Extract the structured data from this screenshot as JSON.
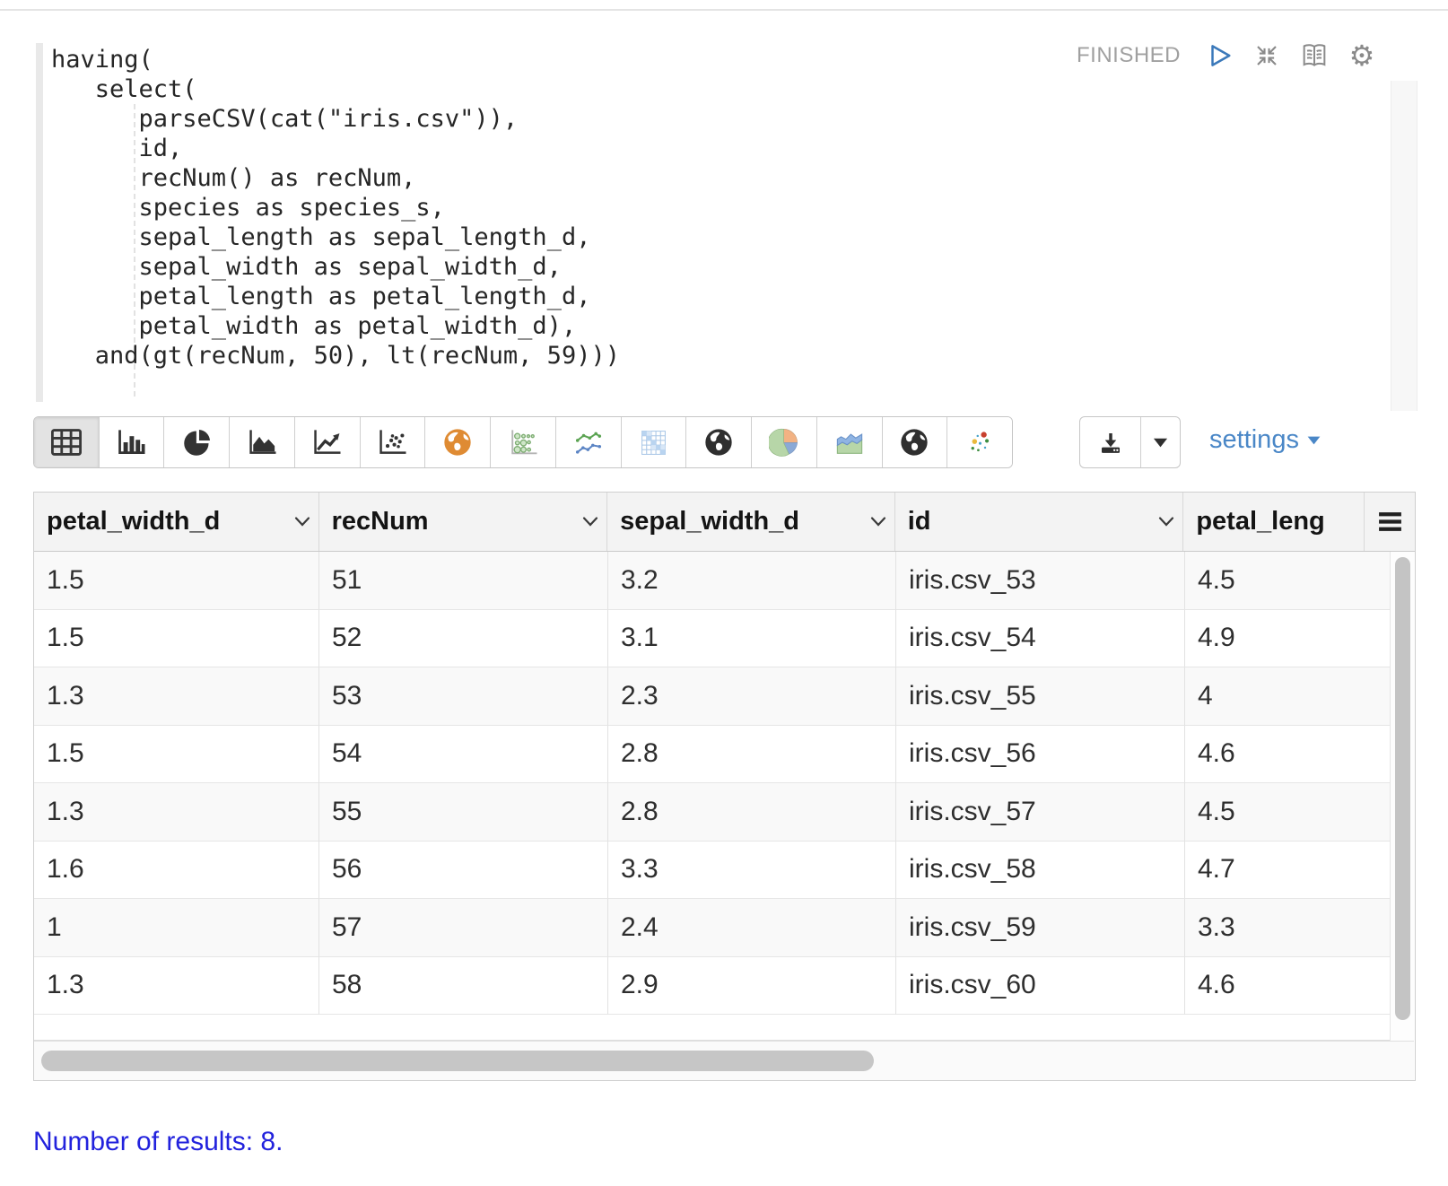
{
  "paragraph": {
    "status": "FINISHED",
    "controls": [
      "play",
      "compress",
      "book",
      "gear"
    ],
    "code": "having(\n   select(\n      parseCSV(cat(\"iris.csv\")),\n      id,\n      recNum() as recNum,\n      species as species_s,\n      sepal_length as sepal_length_d,\n      sepal_width as sepal_width_d,\n      petal_length as petal_length_d,\n      petal_width as petal_width_d),\n   and(gt(recNum, 50), lt(recNum, 59)))"
  },
  "toolbar": {
    "chart_types": [
      "table",
      "bar-chart",
      "pie-chart",
      "area-chart",
      "line-chart",
      "scatter-chart",
      "map-globe-orange",
      "bubble-chart",
      "multi-line-chart",
      "heatmap",
      "globe-dark",
      "pie-chart-colored",
      "area-chart-colored",
      "globe-dark-2",
      "scatter-colored"
    ],
    "selected_chart": "table",
    "settings_label": "settings"
  },
  "table": {
    "columns": [
      {
        "label": "petal_width_d"
      },
      {
        "label": "recNum"
      },
      {
        "label": "sepal_width_d"
      },
      {
        "label": "id"
      },
      {
        "label": "petal_leng"
      }
    ],
    "rows": [
      [
        "1.5",
        "51",
        "3.2",
        "iris.csv_53",
        "4.5"
      ],
      [
        "1.5",
        "52",
        "3.1",
        "iris.csv_54",
        "4.9"
      ],
      [
        "1.3",
        "53",
        "2.3",
        "iris.csv_55",
        "4"
      ],
      [
        "1.5",
        "54",
        "2.8",
        "iris.csv_56",
        "4.6"
      ],
      [
        "1.3",
        "55",
        "2.8",
        "iris.csv_57",
        "4.5"
      ],
      [
        "1.6",
        "56",
        "3.3",
        "iris.csv_58",
        "4.7"
      ],
      [
        "1",
        "57",
        "2.4",
        "iris.csv_59",
        "3.3"
      ],
      [
        "1.3",
        "58",
        "2.9",
        "iris.csv_60",
        "4.6"
      ]
    ]
  },
  "footer": {
    "results_text": "Number of results: 8."
  },
  "colors": {
    "settings_blue": "#4a87c7",
    "results_blue": "#2222dd",
    "play_blue": "#3b79ba",
    "map_orange": "#df8b33",
    "status_gray": "#a0a0a0"
  }
}
